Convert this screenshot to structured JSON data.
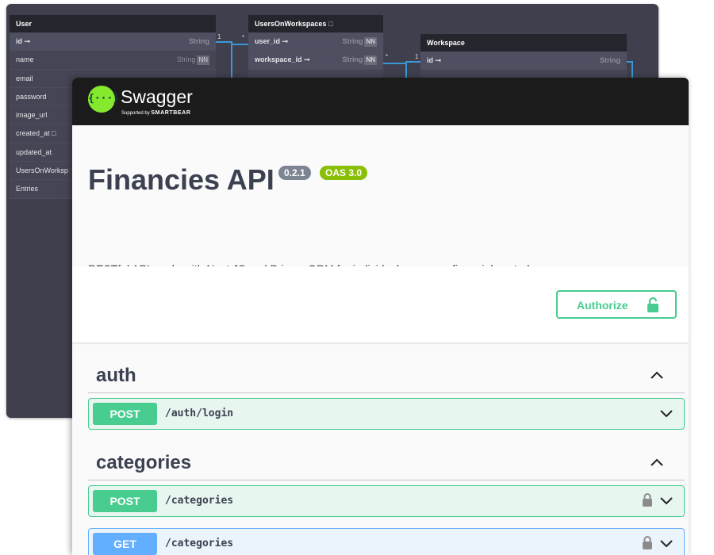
{
  "diagram": {
    "tables": [
      {
        "name": "User",
        "columns": [
          {
            "name": "id",
            "type": "String",
            "key": true,
            "icon": "key-icon"
          },
          {
            "name": "name",
            "type": "String",
            "nn": "NN"
          },
          {
            "name": "email",
            "type": "",
            "nn": ""
          },
          {
            "name": "password",
            "type": "",
            "nn": ""
          },
          {
            "name": "image_url",
            "type": "",
            "nn": ""
          },
          {
            "name": "created_at",
            "type": "",
            "nn": "",
            "icon": "note-icon"
          },
          {
            "name": "updated_at",
            "type": "",
            "nn": ""
          },
          {
            "name": "UsersOnWorksp",
            "type": "",
            "nn": ""
          },
          {
            "name": "Entries",
            "type": "",
            "nn": ""
          }
        ]
      },
      {
        "name": "UsersOnWorkspaces",
        "icon": "note-icon",
        "columns": [
          {
            "name": "user_id",
            "type": "String",
            "nn": "NN",
            "key": true,
            "icon": "key-icon"
          },
          {
            "name": "workspace_id",
            "type": "String",
            "nn": "NN",
            "key": true,
            "icon": "key-icon"
          }
        ]
      },
      {
        "name": "Workspace",
        "columns": [
          {
            "name": "id",
            "type": "String",
            "key": true,
            "icon": "key-icon"
          }
        ]
      }
    ],
    "relations": [
      {
        "from_card": "1",
        "to_card": "*"
      },
      {
        "from_card": "*",
        "to_card": "1"
      }
    ]
  },
  "swagger": {
    "brand": {
      "name": "Swagger",
      "tagline": "Supported by",
      "company": "SMARTBEAR",
      "logo_glyph": "{···}"
    },
    "api": {
      "title": "Financies API",
      "version": "0.2.1",
      "oas": "OAS 3.0",
      "description": "RESTful API made with Nest JS and Prisma ORM for individual or groups financial control"
    },
    "authorize_label": "Authorize",
    "colors": {
      "post": "#49cc90",
      "get": "#61affe",
      "topbar": "#1b1b1b",
      "logo": "#85ea2d"
    },
    "tags": [
      {
        "name": "auth",
        "expanded": true,
        "operations": [
          {
            "method": "POST",
            "path": "/auth/login",
            "locked": false
          }
        ]
      },
      {
        "name": "categories",
        "expanded": true,
        "operations": [
          {
            "method": "POST",
            "path": "/categories",
            "locked": true
          },
          {
            "method": "GET",
            "path": "/categories",
            "locked": true
          }
        ]
      }
    ]
  }
}
